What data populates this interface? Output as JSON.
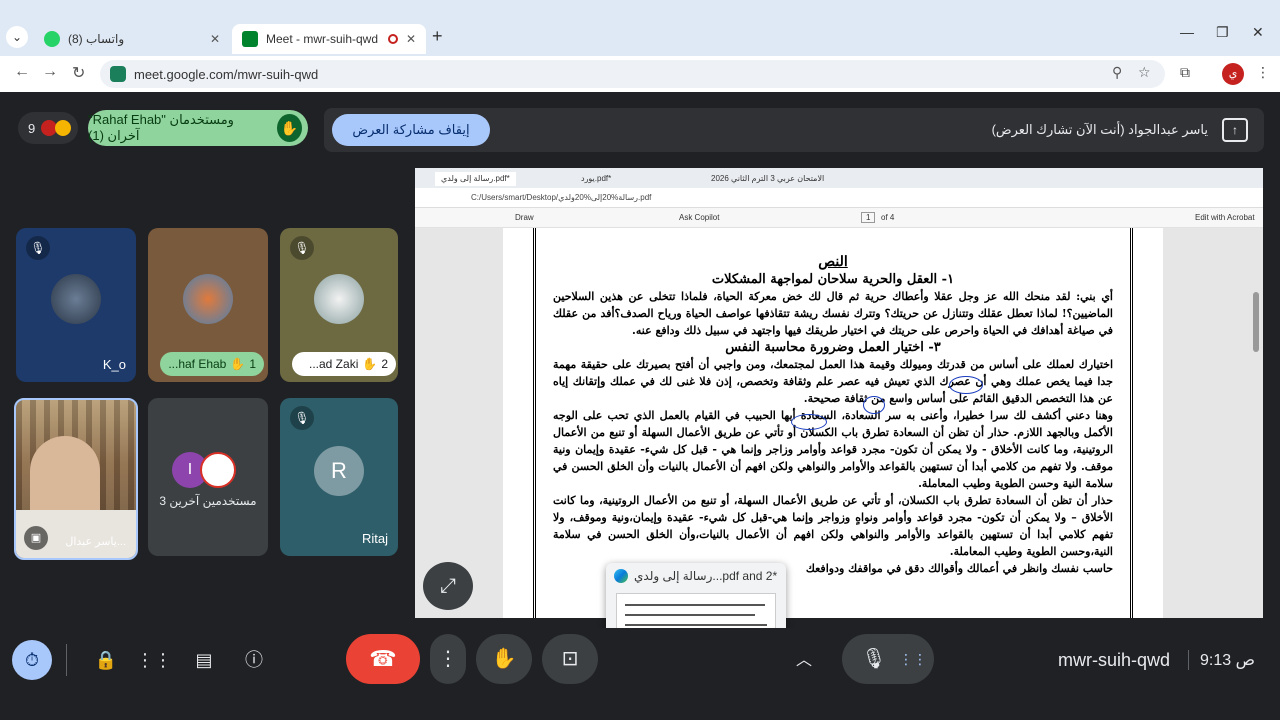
{
  "browser": {
    "tabs": [
      {
        "title": "(8) واتساب",
        "favicon_color": "#25D366"
      },
      {
        "title": "Meet - mwr-suih-qwd",
        "favicon_color": "#00832d"
      }
    ],
    "url": "meet.google.com/mwr-suih-qwd",
    "profile_initial": "ي"
  },
  "meet": {
    "participant_count": "9",
    "hand_raised_text": "\"Rahaf Ehab\" ومستخدمان آخران (1)",
    "stop_sharing_label": "إيقاف مشاركة العرض",
    "presenting_text": "ياسر عبدالجواد (أنت الآن تشارك العرض)",
    "tiles": [
      {
        "name": "K_o"
      },
      {
        "name": "...haf Ehab",
        "order": "1"
      },
      {
        "name": "...ad Zaki",
        "order": "2"
      },
      {
        "name": "ياسر عبدال..."
      },
      {
        "others_label": "3 مستخدمين آخرين",
        "letter": "I"
      },
      {
        "name": "Ritaj",
        "letter": "R"
      }
    ],
    "meeting_code": "mwr-suih-qwd",
    "time": "9:13 ص"
  },
  "shared_screen": {
    "tabs": [
      "رسالة إلى ولدي.pdf*",
      "يورد.pdf*",
      "الامتحان عربي 3 الترم الثاني 2026"
    ],
    "file_path": "C:/Users/smart/Desktop/رسالة%20إلى%20ولدي.pdf",
    "toolbar": {
      "draw": "Draw",
      "copilot": "Ask Copilot",
      "page": "1",
      "of_pages": "of 4",
      "edit_acrobat": "Edit with Acrobat"
    },
    "doc": {
      "title": "النص",
      "heading1": "١- العقل والحرية سلاحان لمواجهة المشكلات",
      "para1": "أي بني: لقد منحك الله عز وجل عقلا وأعطاك حرية ثم قال لك خض معركة الحياة، فلماذا تتخلى عن هذين السلاحين الماضيين؟! لماذا تعطل عقلك وتتنازل عن حريتك؟ وتترك نفسك ريشة تتقاذفها عواصف الحياة ورياح الصدف؟أفد من عقلك في صياغة أهدافك في الحياة واحرص على حريتك في اختيار طريقك فيها واجتهد في سبيل ذلك ودافع عنه.",
      "heading3": "٣- اختيار العمل وضرورة محاسبة النفس",
      "para2": "اختيارك لعملك على أساس من قدرتك وميولك وقيمة هذا العمل لمجتمعك، ومن واجبي أن أفتح بصيرتك على حقيقة مهمة جدا فيما يخص عملك وهي أن عصرك الذي تعيش فيه عصر علم وثقافة وتخصص، إذن فلا غنى لك في عملك وإتقانك إياه عن هذا التخصص الدقيق القائم على أساس واسع من ثقافة صحيحة.",
      "para3": "وهنا دعني أكشف لك سرا خطيرا، وأعنى به سر السعادة، السعادة أيها الحبيب في القيام بالعمل الذي تحب على الوجه الأكمل وبالجهد اللازم. حذار أن تظن أن السعادة تطرق باب الكسلان أو تأتي عن طريق الأعمال السهلة أو تنبع من الأعمال الروتينية، وما كانت الأخلاق - ولا يمكن أن تكون- مجرد قواعد وأوامر وزاجر وإنما هي - قبل كل شيء- عقيدة وإيمان ونية موقف. ولا تفهم من كلامي أبدا أن تستهين بالقواعد والأوامر والنواهي ولكن افهم أن الأعمال بالنيات وأن الخلق الحسن في سلامة النية وحسن الطوية وطيب المعاملة.",
      "para4": "حذار أن تظن أن السعادة تطرق باب الكسلان، أو تأتي عن طريق الأعمال السهلة، أو تنبع من الأعمال الروتينية، وما كانت الأخلاق – ولا يمكن أن تكون- مجرد قواعد وأوامر ونواهٍ وزواجر وإنما هي-قبل كل شيء- عقيدة وإيمان،ونية وموقف، ولا تفهم كلامي أبدا أن تستهين بالقواعد والأوامر والنواهي ولكن افهم أن الأعمال بالنيات،وأن الخلق الحسن في سلامة النية،وحسن الطوية وطيب المعاملة.",
      "para5": "حاسب نفسك وانظر في أعمالك وأقوالك دقق في مواقفك ودوافعك"
    }
  },
  "thumbnail": {
    "title": "رسالة إلى ولدي...pdf and 2*"
  },
  "icons": {
    "raise_hand": "raise-hand-icon",
    "mic_off": "mic-off-icon",
    "end_call": "end-call-icon"
  }
}
